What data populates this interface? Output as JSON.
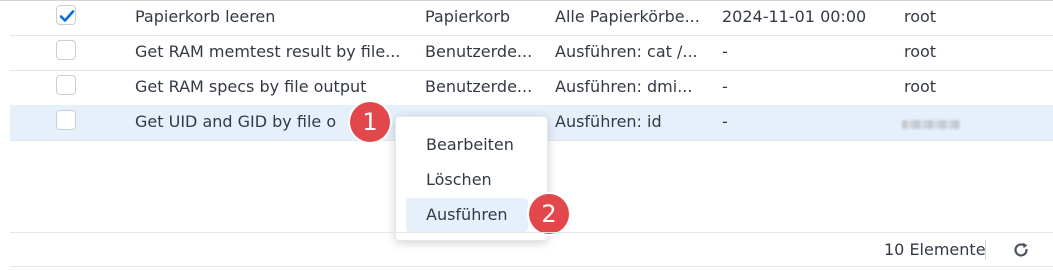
{
  "rows": [
    {
      "checked": true,
      "name": "Papierkorb leeren",
      "type": "Papierkorb",
      "action": "Alle Papierkörbe...",
      "next": "2024-11-01 00:00",
      "owner": "root"
    },
    {
      "checked": false,
      "name": "Get RAM memtest result by file...",
      "type": "Benutzerde...",
      "action": "Ausführen: cat /...",
      "next": "-",
      "owner": "root"
    },
    {
      "checked": false,
      "name": "Get RAM specs by file output",
      "type": "Benutzerde...",
      "action": "Ausführen: dmi...",
      "next": "-",
      "owner": "root"
    },
    {
      "checked": false,
      "name": "Get UID and GID by file o",
      "type": "",
      "action": "Ausführen: id",
      "next": "-",
      "owner": ""
    }
  ],
  "context_menu": {
    "items": [
      "Bearbeiten",
      "Löschen",
      "Ausführen"
    ]
  },
  "badges": [
    "1",
    "2"
  ],
  "footer": {
    "count_label": "10 Elemente"
  },
  "colors": {
    "accent": "#0a6ed1",
    "badge": "#e2474c",
    "selected_row": "#e6f0fb"
  }
}
